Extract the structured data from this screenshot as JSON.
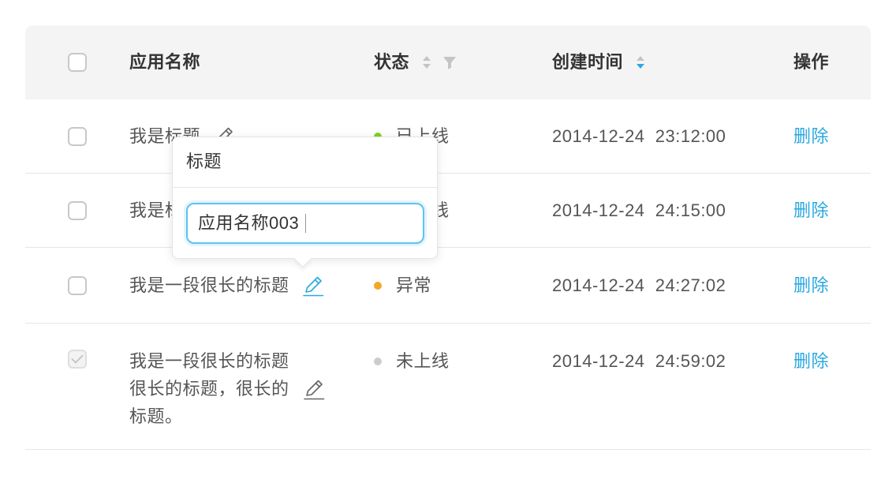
{
  "colors": {
    "accent": "#29a8e0",
    "status_online": "#7ed321",
    "status_error": "#f5a623",
    "status_offline": "#cccccc"
  },
  "icons": {
    "edit": "pencil-icon",
    "sort": "sort-icon",
    "filter": "filter-icon"
  },
  "table": {
    "columns": {
      "name": "应用名称",
      "status": "状态",
      "created_at": "创建时间",
      "actions": "操作"
    },
    "sort": {
      "status": "none",
      "created_at": "descending"
    },
    "rows": [
      {
        "name": "我是标题",
        "status": "已上线",
        "status_color": "#7ed321",
        "created_at": "2014-12-24  23:12:00",
        "action": "删除",
        "checked": false,
        "disabled": false
      },
      {
        "name": "我是标题",
        "status": "已上线",
        "status_color": "#7ed321",
        "created_at": "2014-12-24  24:15:00",
        "action": "删除",
        "checked": false,
        "disabled": false
      },
      {
        "name": "我是一段很长的标题",
        "status": "异常",
        "status_color": "#f5a623",
        "created_at": "2014-12-24  24:27:02",
        "action": "删除",
        "checked": false,
        "disabled": false
      },
      {
        "name": "我是一段很长的标题很长的标题，很长的标题。",
        "status": "未上线",
        "status_color": "#cccccc",
        "created_at": "2014-12-24  24:59:02",
        "action": "删除",
        "checked": true,
        "disabled": true
      }
    ]
  },
  "popover": {
    "title": "标题",
    "input_value": "应用名称003"
  }
}
